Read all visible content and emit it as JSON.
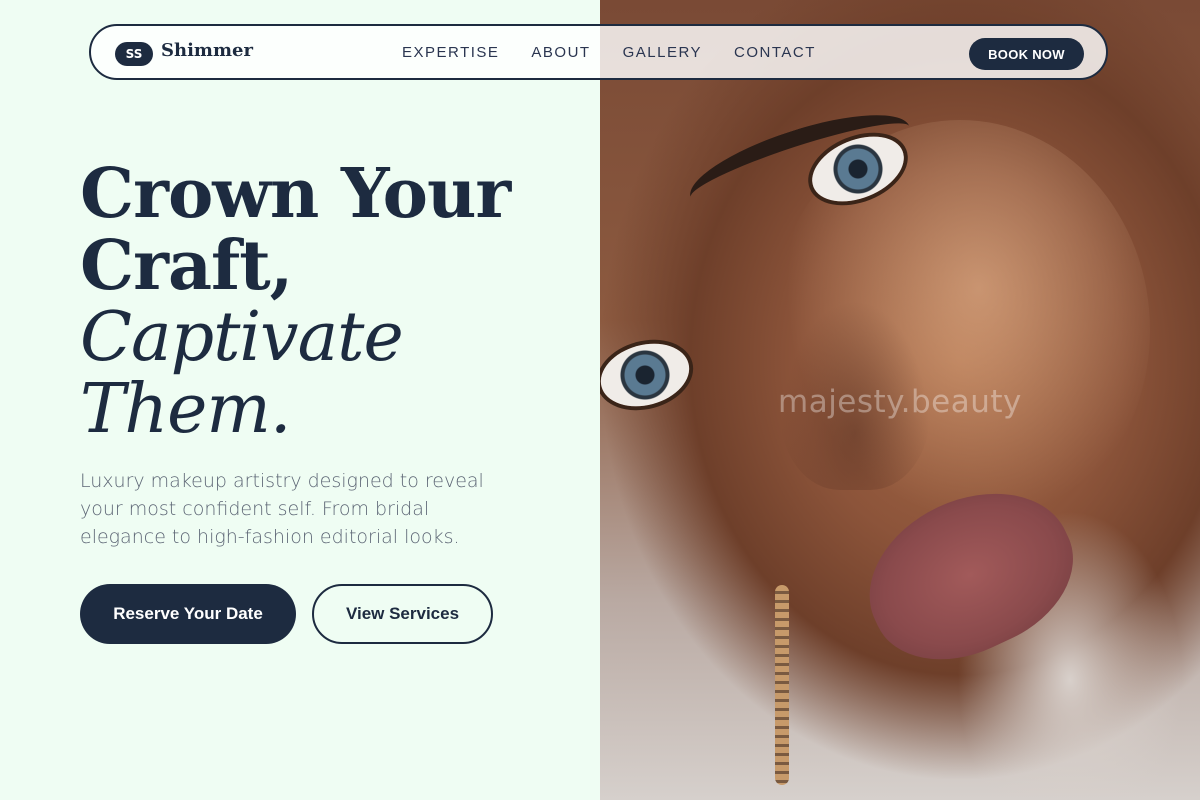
{
  "header": {
    "logo_initials": "SS",
    "logo_name": "Shimmer",
    "nav": [
      "EXPERTISE",
      "ABOUT",
      "GALLERY",
      "CONTACT"
    ],
    "cta_label": "BOOK NOW"
  },
  "hero": {
    "title_line1": "Crown Your",
    "title_line2": "Craft,",
    "title_line3": "Captivate",
    "title_line4": "Them.",
    "subtitle": "Luxury makeup artistry designed to reveal your most confident self. From bridal elegance to high-fashion editorial looks.",
    "primary_button": "Reserve Your Date",
    "secondary_button": "View Services"
  },
  "photo": {
    "watermark": "majesty.beauty"
  },
  "colors": {
    "background": "#effdf3",
    "navy": "#1d2b40",
    "muted_text": "#5d6675"
  }
}
